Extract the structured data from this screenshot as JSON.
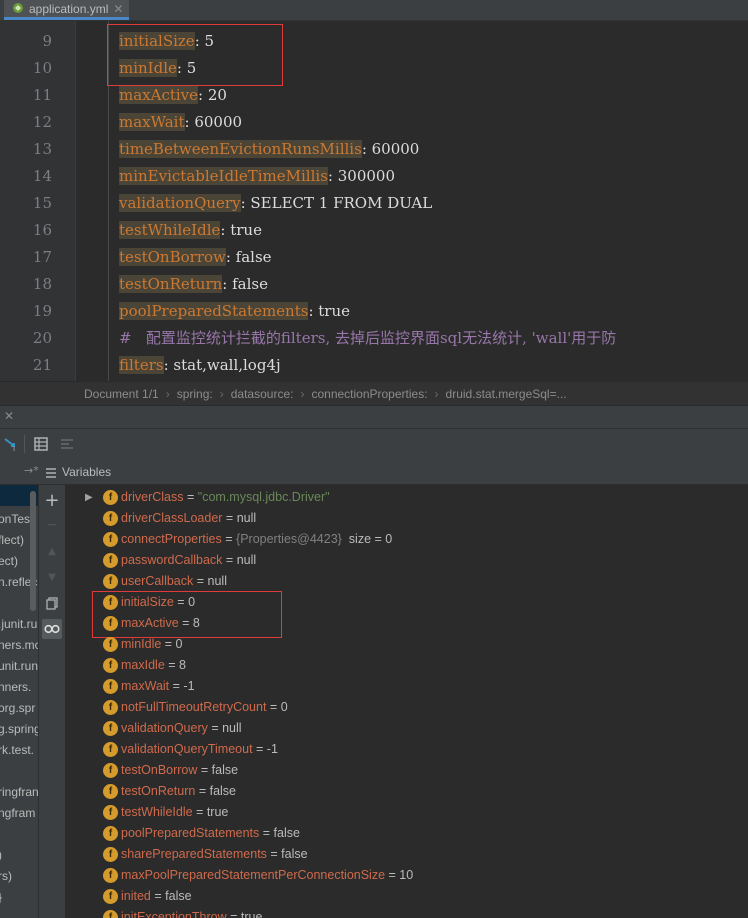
{
  "tab": {
    "title": "application.yml",
    "close": "✕"
  },
  "editor": {
    "lines": [
      {
        "num": "9",
        "key": "initialSize",
        "rest": ": 5"
      },
      {
        "num": "10",
        "key": "minIdle",
        "rest": ": 5"
      },
      {
        "num": "11",
        "key": "maxActive",
        "rest": ": 20"
      },
      {
        "num": "12",
        "key": "maxWait",
        "rest": ": 60000"
      },
      {
        "num": "13",
        "key": "timeBetweenEvictionRunsMillis",
        "rest": ": 60000"
      },
      {
        "num": "14",
        "key": "minEvictableIdleTimeMillis",
        "rest": ": 300000"
      },
      {
        "num": "15",
        "key": "validationQuery",
        "rest": ": SELECT 1 FROM DUAL"
      },
      {
        "num": "16",
        "key": "testWhileIdle",
        "rest": ": true"
      },
      {
        "num": "17",
        "key": "testOnBorrow",
        "rest": ": false"
      },
      {
        "num": "18",
        "key": "testOnReturn",
        "rest": ": false"
      },
      {
        "num": "19",
        "key": "poolPreparedStatements",
        "rest": ": true"
      },
      {
        "num": "20",
        "comment": "#   配置监控统计拦截的filters, 去掉后监控界面sql无法统计, 'wall'用于防"
      },
      {
        "num": "21",
        "key": "filters",
        "rest": ": stat,wall,log4j"
      }
    ]
  },
  "breadcrumb": [
    "Document 1/1",
    "spring:",
    "datasource:",
    "connectionProperties:",
    "druid.stat.mergeSql=..."
  ],
  "debugger": {
    "variables_label": "Variables",
    "frames": [
      "onTest",
      "flect)",
      "ect)",
      "n.reflec",
      "",
      ".junit.ru",
      "ners.mo",
      "unit.run",
      "nners.",
      "org.spr",
      "g.spring",
      "rk.test.",
      "",
      "ringfran",
      "ngfram",
      "",
      ")",
      "rs)",
      "}",
      ""
    ],
    "variables": [
      {
        "expandable": true,
        "name": "driverClass",
        "eq": " = ",
        "value": "\"com.mysql.jdbc.Driver\"",
        "kind": "str"
      },
      {
        "name": "driverClassLoader",
        "eq": " = ",
        "value": "null"
      },
      {
        "name": "connectProperties",
        "eq": " = ",
        "value": "{Properties@4423}",
        "kind": "obj",
        "extra": "  size = 0"
      },
      {
        "name": "passwordCallback",
        "eq": " = ",
        "value": "null"
      },
      {
        "name": "userCallback",
        "eq": " = ",
        "value": "null"
      },
      {
        "name": "initialSize",
        "eq": " = ",
        "value": "0"
      },
      {
        "name": "maxActive",
        "eq": " = ",
        "value": "8"
      },
      {
        "name": "minIdle",
        "eq": " = ",
        "value": "0"
      },
      {
        "name": "maxIdle",
        "eq": " = ",
        "value": "8"
      },
      {
        "name": "maxWait",
        "eq": " = ",
        "value": "-1"
      },
      {
        "name": "notFullTimeoutRetryCount",
        "eq": " = ",
        "value": "0"
      },
      {
        "name": "validationQuery",
        "eq": " = ",
        "value": "null"
      },
      {
        "name": "validationQueryTimeout",
        "eq": " = ",
        "value": "-1"
      },
      {
        "name": "testOnBorrow",
        "eq": " = ",
        "value": "false"
      },
      {
        "name": "testOnReturn",
        "eq": " = ",
        "value": "false"
      },
      {
        "name": "testWhileIdle",
        "eq": " = ",
        "value": "true"
      },
      {
        "name": "poolPreparedStatements",
        "eq": " = ",
        "value": "false"
      },
      {
        "name": "sharePreparedStatements",
        "eq": " = ",
        "value": "false"
      },
      {
        "name": "maxPoolPreparedStatementPerConnectionSize",
        "eq": " = ",
        "value": "10"
      },
      {
        "name": "inited",
        "eq": " = ",
        "value": "false"
      },
      {
        "name": "initExceptionThrow",
        "eq": " = ",
        "value": "true"
      }
    ],
    "field_icon_letter": "f"
  },
  "colors": {
    "highlight_box": "#e03a3a",
    "key": "#cc7832",
    "field_name": "#cf6a4c",
    "string": "#6a8759"
  }
}
